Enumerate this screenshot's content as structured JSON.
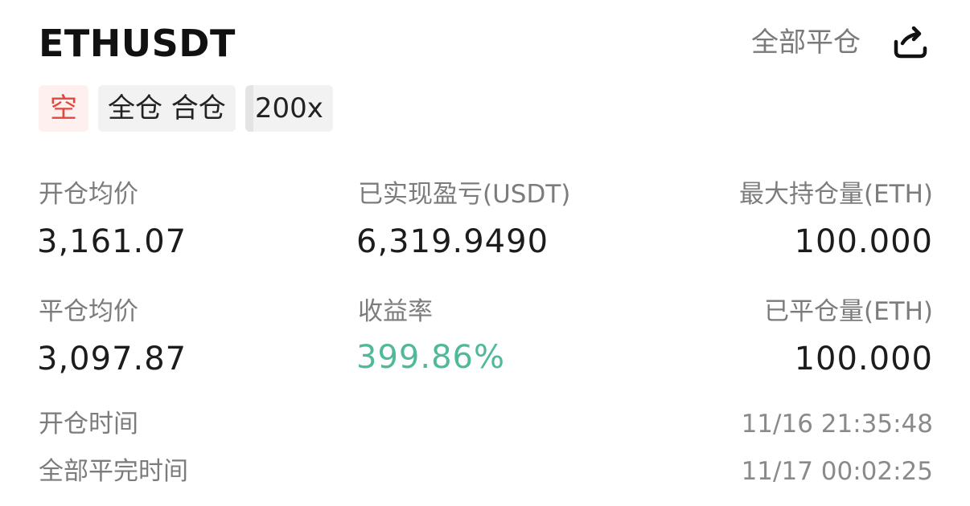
{
  "header": {
    "symbol": "ETHUSDT",
    "close_all_label": "全部平仓",
    "share_icon": "share-icon"
  },
  "tags": {
    "direction": "空",
    "margin_mode": "全仓 合仓",
    "leverage": "200x"
  },
  "stats": {
    "open_avg_price_label": "开仓均价",
    "open_avg_price": "3,161.07",
    "realized_pnl_label": "已实现盈亏(USDT)",
    "realized_pnl": "6,319.9490",
    "max_position_label": "最大持仓量(ETH)",
    "max_position": "100.000",
    "close_avg_price_label": "平仓均价",
    "close_avg_price": "3,097.87",
    "roi_label": "收益率",
    "roi": "399.86%",
    "closed_amount_label": "已平仓量(ETH)",
    "closed_amount": "100.000"
  },
  "times": {
    "open_time_label": "开仓时间",
    "open_time": "11/16 21:35:48",
    "close_time_label": "全部平完时间",
    "close_time": "11/17 00:02:25"
  },
  "colors": {
    "short": "#e0473d",
    "profit": "#4fb99a"
  }
}
